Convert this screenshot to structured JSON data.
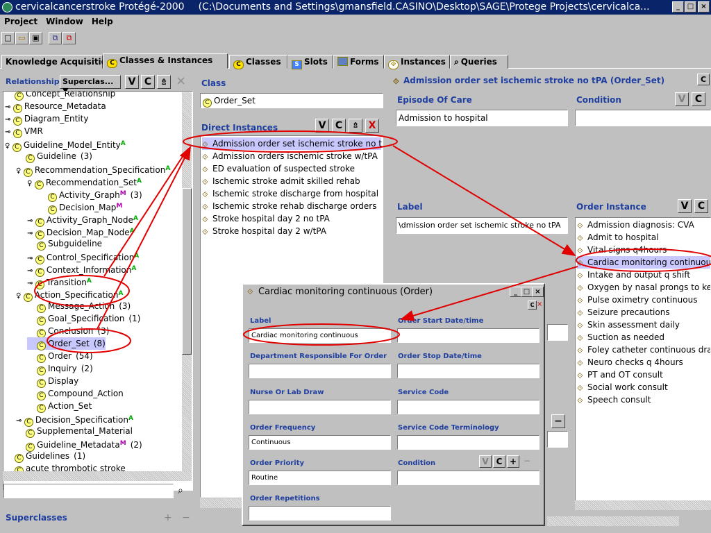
{
  "window": {
    "title": "cervicalcancerstroke  Protégé-2000",
    "path": "(C:\\Documents and Settings\\gmansfield.CASINO\\Desktop\\SAGE\\Protege Projects\\cervicalca..."
  },
  "menu": [
    "Project",
    "Window",
    "Help"
  ],
  "tabs": [
    "Knowledge Acquisition",
    "Classes & Instances",
    "Classes",
    "Slots",
    "Forms",
    "Instances",
    "Queries"
  ],
  "tab_icons": {
    "classes_instances": "C-circle-instance-icon",
    "classes": "C-circle-icon",
    "slots": "S-icon",
    "forms": "form-icon",
    "instances": "instance-icon",
    "queries": "binoculars-icon"
  },
  "relationship": {
    "label": "Relationship",
    "value": "Superclas...",
    "btn_v": "V",
    "btn_c": "C"
  },
  "class_tree": [
    {
      "name": "Concept_Relationship",
      "note": ""
    },
    {
      "name": "Resource_Metadata",
      "note": ""
    },
    {
      "name": "Diagram_Entity",
      "note": ""
    },
    {
      "name": "VMR",
      "note": ""
    },
    {
      "name": "Guideline_Model_Entity",
      "badge": "A",
      "note": ""
    },
    {
      "name": "Guideline",
      "note": "(3)"
    },
    {
      "name": "Recommendation_Specification",
      "badge": "A",
      "note": ""
    },
    {
      "name": "Recommendation_Set",
      "badge": "A",
      "note": ""
    },
    {
      "name": "Activity_Graph",
      "badge": "M",
      "note": "(3)"
    },
    {
      "name": "Decision_Map",
      "badge": "M",
      "note": ""
    },
    {
      "name": "Activity_Graph_Node",
      "badge": "A",
      "note": ""
    },
    {
      "name": "Decision_Map_Node",
      "badge": "A",
      "note": ""
    },
    {
      "name": "Subguideline",
      "note": ""
    },
    {
      "name": "Control_Specification",
      "badge": "A",
      "note": ""
    },
    {
      "name": "Context_Information",
      "badge": "A",
      "note": ""
    },
    {
      "name": "Transition",
      "badge": "A",
      "note": ""
    },
    {
      "name": "Action_Specification",
      "badge": "A",
      "note": ""
    },
    {
      "name": "Message_Action",
      "note": "(3)"
    },
    {
      "name": "Goal_Specification",
      "note": "(1)"
    },
    {
      "name": "Conclusion",
      "note": "(3)"
    },
    {
      "name": "Order_Set",
      "note": "(8)"
    },
    {
      "name": "Order",
      "note": "(54)"
    },
    {
      "name": "Inquiry",
      "note": "(2)"
    },
    {
      "name": "Display",
      "note": ""
    },
    {
      "name": "Compound_Action",
      "note": ""
    },
    {
      "name": "Action_Set",
      "note": ""
    },
    {
      "name": "Decision_Specification",
      "badge": "A",
      "note": ""
    },
    {
      "name": "Supplemental_Material",
      "note": ""
    },
    {
      "name": "Guideline_Metadata",
      "badge": "M",
      "note": "(2)"
    },
    {
      "name": "Guidelines",
      "note": "(1)"
    },
    {
      "name": "acute thrombotic stroke",
      "note": ""
    }
  ],
  "superclasses": {
    "label": "Superclasses",
    "add": "+",
    "remove": "−"
  },
  "class_panel": {
    "header": "Class",
    "value": "Order_Set",
    "instances_header": "Direct Instances",
    "btn_v": "V",
    "btn_c": "C",
    "btn_x": "X"
  },
  "instances": [
    "Admission order set ischemic stroke no tPA",
    "Admission orders ischemic stroke w/tPA",
    "ED evaluation of suspected stroke",
    "Ischemic stroke admit skilled rehab",
    "Ischemic stroke discharge from hospital",
    "Ischemic stroke rehab discharge orders",
    "Stroke hospital day 2 no tPA",
    "Stroke hospital day 2 w/tPA"
  ],
  "form": {
    "header": "Admission order set ischemic stroke no tPA  (Order_Set)",
    "header_btn": "C",
    "episode_label": "Episode Of Care",
    "episode_value": "Admission to hospital",
    "condition_label": "Condition",
    "condition_value": "",
    "label_label": "Label",
    "label_value": "\\dmission order set ischemic stroke no tPA",
    "order_instance_label": "Order Instance",
    "btn_v": "V",
    "btn_c": "C",
    "minus": "−",
    "order_instances": [
      "Admission diagnosis: CVA",
      "Admit to hospital",
      "Vital signs q4hours",
      "Cardiac monitoring continuous",
      "Intake and output q shift",
      "Oxygen by nasal prongs to keep",
      "Pulse oximetry continuous",
      "Seizure precautions",
      "Skin assessment daily",
      "Suction as needed",
      "Foley catheter continuous drain",
      "Neuro checks q 4hours",
      "PT and OT consult",
      "Social work consult",
      "Speech consult"
    ]
  },
  "dialog": {
    "title": "Cardiac monitoring continuous  (Order)",
    "fields": {
      "label": {
        "label": "Label",
        "value": "Cardiac monitoring continuous"
      },
      "start": {
        "label": "Order Start Date/time",
        "value": ""
      },
      "dept": {
        "label": "Department Responsible For Order",
        "value": ""
      },
      "stop": {
        "label": "Order Stop Date/time",
        "value": ""
      },
      "nurse": {
        "label": "Nurse Or Lab Draw",
        "value": ""
      },
      "service": {
        "label": "Service Code",
        "value": ""
      },
      "freq": {
        "label": "Order Frequency",
        "value": "Continuous"
      },
      "term": {
        "label": "Service Code Terminology",
        "value": ""
      },
      "priority": {
        "label": "Order Priority",
        "value": "Routine"
      },
      "cond": {
        "label": "Condition",
        "value": ""
      },
      "rep": {
        "label": "Order Repetitions",
        "value": ""
      }
    },
    "cond_btns": {
      "v": "V",
      "c": "C",
      "plus": "+",
      "minus": "−"
    }
  },
  "annotation_color": "#e00000"
}
